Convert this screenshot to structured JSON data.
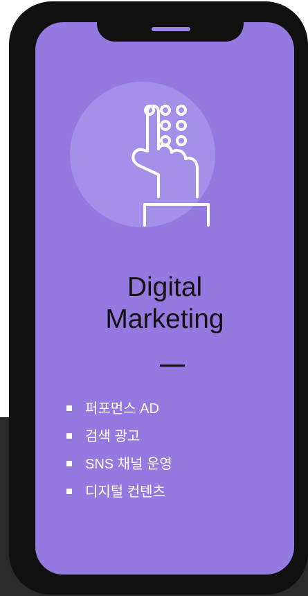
{
  "card": {
    "icon": "hand-touch-keypad-icon",
    "title_line1": "Digital",
    "title_line2": "Marketing",
    "services": [
      "퍼포먼스 AD",
      "검색 광고",
      "SNS 채널 운영",
      "디지털 컨텐츠"
    ]
  },
  "colors": {
    "screen": "#9379e0",
    "frame": "#101010",
    "icon_circle": "#a48fe9",
    "text_dark": "#111111",
    "text_light": "#ffffff",
    "background_dark": "#2a2a2a"
  }
}
